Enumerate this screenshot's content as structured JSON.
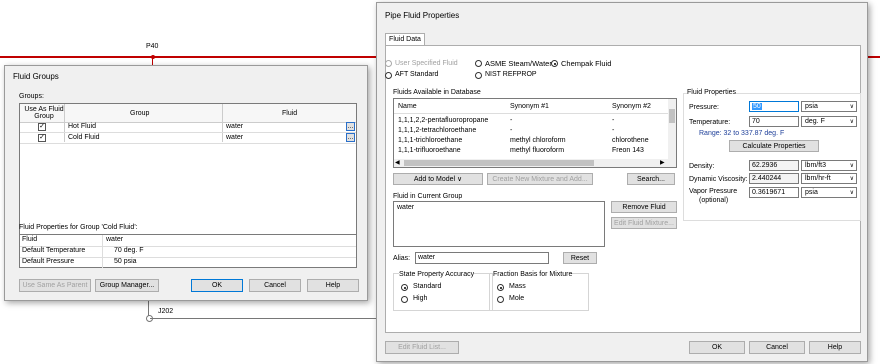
{
  "canvas": {
    "pipe_label_top": "P40",
    "pipe_label_bottom": "J202",
    "pipe_color": "#c00000"
  },
  "fluid_groups": {
    "title": "Fluid Groups",
    "groups_label": "Groups:",
    "headers": [
      "Use As Fluid Group",
      "Group",
      "Fluid"
    ],
    "rows": [
      {
        "checked": "✓",
        "group": "Hot Fluid",
        "fluid": "water",
        "browse": "..."
      },
      {
        "checked": "✓",
        "group": "Cold Fluid",
        "fluid": "water",
        "browse": "..."
      }
    ],
    "props_label": "Fluid Properties for Group 'Cold Fluid':",
    "props": [
      {
        "name": "Fluid",
        "value": "water"
      },
      {
        "name": "Default Temperature",
        "value": "70  deg. F"
      },
      {
        "name": "Default Pressure",
        "value": "50  psia"
      }
    ],
    "buttons": {
      "use_same": "Use Same As Parent",
      "group_manager": "Group Manager...",
      "ok": "OK",
      "cancel": "Cancel",
      "help": "Help"
    }
  },
  "pipe_fluid": {
    "title": "Pipe Fluid Properties",
    "tab": "Fluid Data",
    "sources": {
      "user_specified": "User Specified Fluid",
      "asme": "ASME Steam/Water",
      "chempak": "Chempak Fluid",
      "aft": "AFT Standard",
      "nist": "NIST REFPROP"
    },
    "available_label": "Fluids Available in Database",
    "available_headers": [
      "Name",
      "Synonym #1",
      "Synonym #2"
    ],
    "available_rows": [
      {
        "name": "1,1,1,2,2-pentafluoropropane",
        "syn1": "-",
        "syn2": "-"
      },
      {
        "name": "1,1,1,2-tetrachloroethane",
        "syn1": "-",
        "syn2": "-"
      },
      {
        "name": "1,1,1-trichloroethane",
        "syn1": "methyl chloroform",
        "syn2": "chlorothene"
      },
      {
        "name": "1,1,1-trifluoroethane",
        "syn1": "methyl fluoroform",
        "syn2": "Freon 143"
      }
    ],
    "add_to_model": "Add to Model  ∨",
    "create_mixture": "Create New Mixture and Add...",
    "search": "Search...",
    "current_group_label": "Fluid in Current Group",
    "current_fluid": "water",
    "remove_fluid": "Remove Fluid",
    "edit_mixture": "Edit Fluid Mixture...",
    "alias_label": "Alias:",
    "alias_value": "water",
    "reset": "Reset",
    "accuracy_label": "State Property Accuracy",
    "accuracy_standard": "Standard",
    "accuracy_high": "High",
    "fraction_label": "Fraction Basis for Mixture",
    "fraction_mass": "Mass",
    "fraction_mole": "Mole",
    "edit_fluid_list": "Edit Fluid List...",
    "ok": "OK",
    "cancel": "Cancel",
    "help": "Help",
    "props_group": "Fluid Properties",
    "pressure_label": "Pressure:",
    "pressure_value": "50",
    "pressure_unit": "psia",
    "temperature_label": "Temperature:",
    "temperature_value": "70",
    "temperature_unit": "deg. F",
    "range_text": "Range: 32 to 337.87 deg. F",
    "calc_button": "Calculate Properties",
    "density_label": "Density:",
    "density_value": "62.2936",
    "density_unit": "lbm/ft3",
    "viscosity_label": "Dynamic Viscosity:",
    "viscosity_value": "2.440244",
    "viscosity_unit": "lbm/hr-ft",
    "vapor_label": "Vapor Pressure",
    "vapor_sub": "(optional)",
    "vapor_value": "0.3619671",
    "vapor_unit": "psia"
  }
}
